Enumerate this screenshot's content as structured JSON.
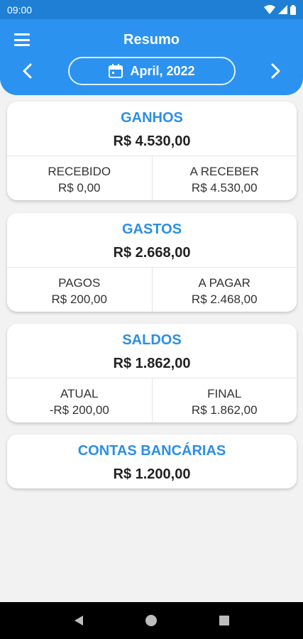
{
  "status_bar": {
    "time": "09:00"
  },
  "header": {
    "title": "Resumo",
    "month": "April, 2022"
  },
  "cards": {
    "ganhos": {
      "title": "GANHOS",
      "total": "R$ 4.530,00",
      "left_label": "RECEBIDO",
      "left_value": "R$ 0,00",
      "right_label": "A RECEBER",
      "right_value": "R$ 4.530,00"
    },
    "gastos": {
      "title": "GASTOS",
      "total": "R$ 2.668,00",
      "left_label": "PAGOS",
      "left_value": "R$ 200,00",
      "right_label": "A PAGAR",
      "right_value": "R$ 2.468,00"
    },
    "saldos": {
      "title": "SALDOS",
      "total": "R$ 1.862,00",
      "left_label": "ATUAL",
      "left_value": "-R$ 200,00",
      "right_label": "FINAL",
      "right_value": "R$ 1.862,00"
    },
    "contas": {
      "title": "CONTAS BANCÁRIAS",
      "total": "R$ 1.200,00"
    }
  },
  "icons": {
    "menu": "menu-icon",
    "prev": "chevron-left-icon",
    "next": "chevron-right-icon",
    "calendar": "calendar-icon",
    "back": "back-triangle-icon",
    "home": "home-circle-icon",
    "recents": "recents-square-icon"
  },
  "colors": {
    "header": "#2b92f0",
    "status_bar": "#1e7fd4",
    "accent_text": "#2b8fe6",
    "background": "#f2f2f2"
  }
}
